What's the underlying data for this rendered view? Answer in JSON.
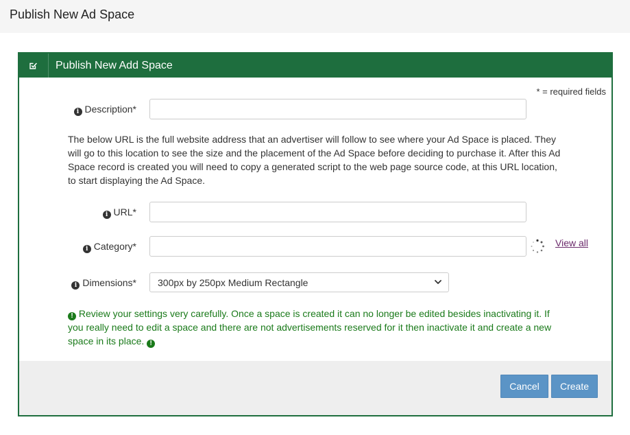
{
  "page": {
    "title": "Publish New Ad Space"
  },
  "panel": {
    "title": "Publish New Add Space",
    "required_note": "* = required fields"
  },
  "form": {
    "description": {
      "label": "Description*",
      "value": "",
      "placeholder": ""
    },
    "url_help": "The below URL is the full website address that an advertiser will follow to see where your Ad Space is placed. They will go to this location to see the size and the placement of the Ad Space before deciding to purchase it. After this Ad Space record is created you will need to copy a generated script to the web page source code, at this URL location, to start displaying the Ad Space.",
    "url": {
      "label": "URL*",
      "value": "",
      "placeholder": ""
    },
    "category": {
      "label": "Category*",
      "value": "",
      "placeholder": "",
      "view_all": "View all"
    },
    "dimensions": {
      "label": "Dimensions*",
      "selected": "300px by 250px Medium Rectangle"
    },
    "warning": "Review your settings very carefully. Once a space is created it can no longer be edited besides inactivating it. If you really need to edit a space and there are not advertisements reserved for it then inactivate it and create a new space in its place."
  },
  "footer": {
    "cancel_label": "Cancel",
    "create_label": "Create"
  },
  "icons": {
    "heading": "edit-check-icon",
    "field_info": "info-circle-icon",
    "loading": "spinner-icon",
    "warning": "exclamation-circle-icon",
    "select": "chevron-down-icon"
  },
  "colors": {
    "panel_header": "#1e6e3e",
    "button": "#5b94c6",
    "warning_text": "#1a7a1a",
    "link": "#6b2a6b"
  }
}
